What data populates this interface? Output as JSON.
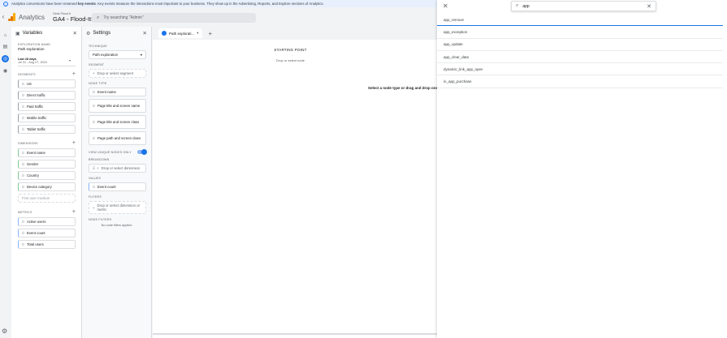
{
  "banner": {
    "prefix": "Analytics conversions have been renamed",
    "bold": "key events",
    "suffix": ". Key events measure the interactions most important to your business. They show up in the Advertising, Reports, and Explore sections of Analytics."
  },
  "header": {
    "app_name": "Analytics",
    "account": "Geek Flood-It",
    "property": "GA4 - Flood-It!",
    "search_placeholder": "Try searching \"Admin\""
  },
  "variables": {
    "title": "Variables",
    "exploration_name_label": "EXPLORATION NAME:",
    "exploration_name": "Path exploration",
    "date_label": "Last 28 days",
    "date_range": "Jul 31 - Aug 27, 2024",
    "segments_label": "SEGMENTS",
    "segments": [
      "US",
      "Direct traffic",
      "Paid traffic",
      "Mobile traffic",
      "Tablet traffic"
    ],
    "dimensions_label": "DIMENSIONS",
    "dimensions": [
      "Event name",
      "Gender",
      "Country",
      "Device category"
    ],
    "dimension_placeholder": "First user medium",
    "metrics_label": "METRICS",
    "metrics": [
      "Active users",
      "Event count",
      "Total users"
    ]
  },
  "settings": {
    "title": "Settings",
    "technique_label": "TECHNIQUE",
    "technique_value": "Path exploration",
    "segment_label": "SEGMENT",
    "segment_add": "Drop or select segment",
    "node_type_label": "NODE TYPE",
    "node_types": [
      "Event name",
      "Page title and screen name",
      "Page title and screen class",
      "Page path and screen class"
    ],
    "view_unique_label": "VIEW UNIQUE NODES ONLY",
    "breakdown_label": "BREAKDOWN",
    "breakdown_add": "Drop or select dimension",
    "values_label": "VALUES",
    "value": "Event count",
    "filters_label": "FILTERS",
    "filters_add": "Drop or select dimension or metric",
    "node_filters_label": "NODE FILTERS",
    "node_filters_empty": "No node filters applied"
  },
  "canvas": {
    "tab_label": "Path explorati...",
    "starting_point": "STARTING POINT",
    "drop_node": "Drop or select node",
    "hint": "Select a node type or drag and drop one fr"
  },
  "overlay": {
    "search_value": "app",
    "items": [
      "app_remove",
      "app_exception",
      "app_update",
      "app_clear_data",
      "dynamic_link_app_open",
      "in_app_purchase"
    ]
  },
  "colors": {
    "accent": "#1a73e8",
    "logo_orange": "#e37400",
    "logo_yellow": "#f9ab00"
  }
}
